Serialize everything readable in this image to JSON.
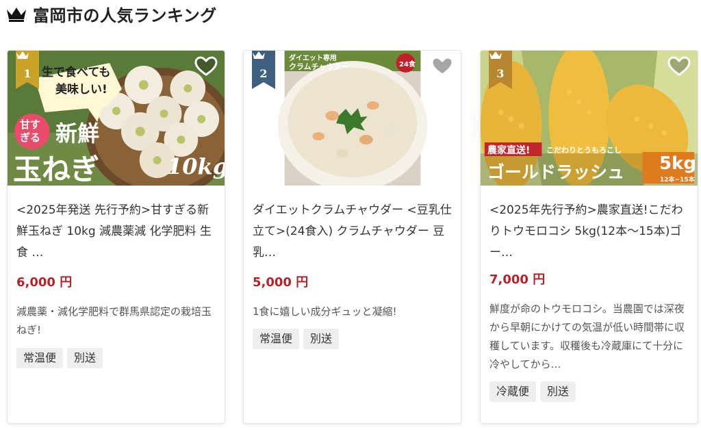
{
  "header": {
    "title": "富岡市の人気ランキング"
  },
  "cards": [
    {
      "rank": "1",
      "title": "<2025年発送 先行予約>甘すぎる新鮮玉ねぎ 10kg 減農薬減 化学肥料 生食 …",
      "price": "6,000 円",
      "description": "減農薬・減化学肥料で群馬県認定の栽培玉ねぎ!",
      "tags": [
        "常温便",
        "別送"
      ],
      "image_text": {
        "line1": "生で食べても",
        "line2": "美味しい!",
        "badge_top": "甘す",
        "badge_bottom": "ぎる",
        "fresh": "新鮮",
        "name": "玉ねぎ",
        "weight": "10kg"
      }
    },
    {
      "rank": "2",
      "title": "ダイエットクラムチャウダー <豆乳仕立て>(24食入) クラムチャウダー 豆乳…",
      "price": "5,000 円",
      "description": "1食に嬉しい成分ギュッと凝縮!",
      "tags": [
        "常温便",
        "別送"
      ],
      "image_text": {
        "line1": "ダイエット専用",
        "line2": "クラムチャウダー",
        "count": "24食"
      }
    },
    {
      "rank": "3",
      "title": "<2025年先行予約>農家直送!こだわりトウモロコシ 5kg(12本〜15本)ゴー…",
      "price": "7,000 円",
      "description": "鮮度が命のトウモロコシ。当農園では深夜から早朝にかけての気温が低い時間帯に収穫しています。収穫後も冷蔵庫にて十分に冷やしてから…",
      "tags": [
        "冷蔵便",
        "別送"
      ],
      "image_text": {
        "direct": "農家直送!",
        "sub": "こだわりとうもろこし",
        "name": "ゴールドラッシュ",
        "weight": "5kg",
        "count": "12本~15本"
      }
    }
  ],
  "colors": {
    "price": "#b4232a",
    "rank1": "#c9a227",
    "rank2": "#3f5f7f",
    "rank3": "#b7862f"
  },
  "icons": {
    "header": "crown-icon",
    "favorite": "heart-outline-icon"
  }
}
